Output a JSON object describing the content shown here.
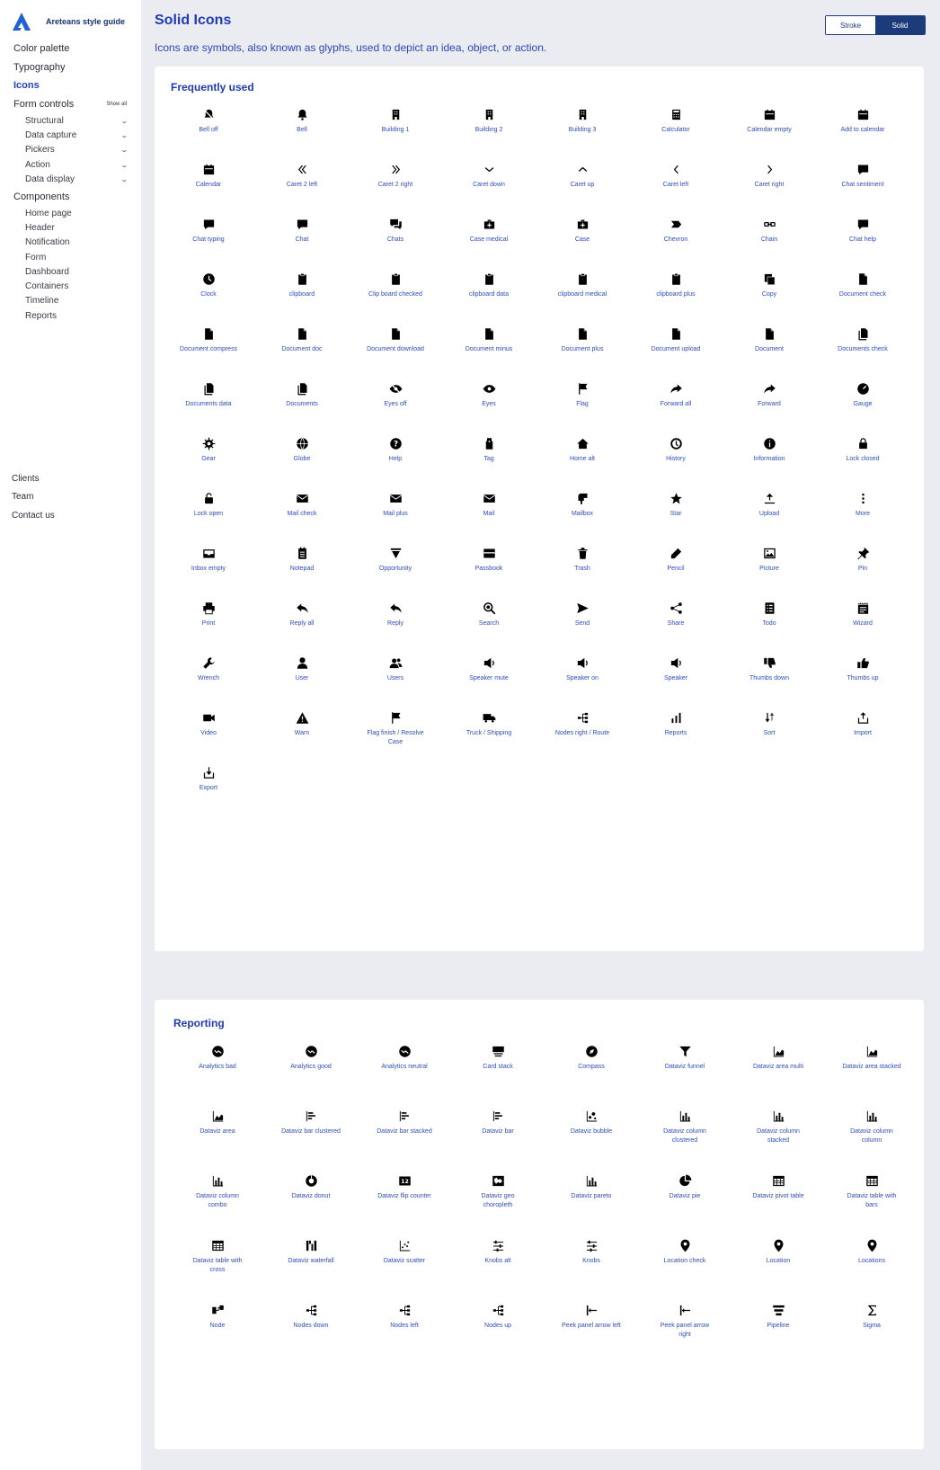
{
  "sidebar": {
    "brand": "Areteans style guide",
    "items": [
      {
        "label": "Color palette"
      },
      {
        "label": "Typography"
      },
      {
        "label": "Icons",
        "active": true
      },
      {
        "label": "Form controls",
        "action": "Show all"
      }
    ],
    "form_controls": [
      "Structural",
      "Data capture",
      "Pickers",
      "Action",
      "Data display"
    ],
    "components_label": "Components",
    "components": [
      "Home page",
      "Header",
      "Notification",
      "Form",
      "Dashboard",
      "Containers",
      "Timeline",
      "Reports"
    ],
    "bottom": [
      "Clients",
      "Team",
      "Contact us"
    ]
  },
  "header": {
    "title": "Solid Icons",
    "description": "Icons are symbols, also known as glyphs, used to depict an idea, object, or action.",
    "toggle": {
      "stroke": "Stroke",
      "solid": "Solid"
    }
  },
  "colors": {
    "accent": "#1e3ab8",
    "link": "#2f4cc8",
    "toggle_active": "#1c3b7a",
    "page_bg": "#ebecf1"
  },
  "sections": [
    {
      "title": "Frequently used",
      "icons": [
        {
          "label": "Bell off",
          "icon": "bell-off-icon"
        },
        {
          "label": "Bell",
          "icon": "bell-icon"
        },
        {
          "label": "Building 1",
          "icon": "building-icon"
        },
        {
          "label": "Building 2",
          "icon": "building-icon"
        },
        {
          "label": "Building 3",
          "icon": "building-icon"
        },
        {
          "label": "Calculator",
          "icon": "calculator-icon"
        },
        {
          "label": "Calendar empty",
          "icon": "calendar-icon"
        },
        {
          "label": "Add to calendar",
          "icon": "calendar-icon"
        },
        {
          "label": "Calendar",
          "icon": "calendar-icon"
        },
        {
          "label": "Caret 2 left",
          "icon": "caret-double-left-icon"
        },
        {
          "label": "Caret 2 right",
          "icon": "caret-double-right-icon"
        },
        {
          "label": "Caret down",
          "icon": "caret-down-icon"
        },
        {
          "label": "Caret up",
          "icon": "caret-up-icon"
        },
        {
          "label": "Caret left",
          "icon": "caret-left-icon"
        },
        {
          "label": "Caret right",
          "icon": "caret-right-icon"
        },
        {
          "label": "Chat sentiment",
          "icon": "chat-icon"
        },
        {
          "label": "Chat typing",
          "icon": "chat-icon"
        },
        {
          "label": "Chat",
          "icon": "chat-icon"
        },
        {
          "label": "Chats",
          "icon": "chats-icon"
        },
        {
          "label": "Case medical",
          "icon": "case-icon"
        },
        {
          "label": "Case",
          "icon": "case-icon"
        },
        {
          "label": "Chevron",
          "icon": "chevron-icon"
        },
        {
          "label": "Chain",
          "icon": "chain-icon"
        },
        {
          "label": "Chat help",
          "icon": "chat-icon"
        },
        {
          "label": "Clock",
          "icon": "clock-icon"
        },
        {
          "label": "clipboard",
          "icon": "clipboard-icon"
        },
        {
          "label": "Clip board checked",
          "icon": "clipboard-icon"
        },
        {
          "label": "clipboard data",
          "icon": "clipboard-icon"
        },
        {
          "label": "clipboard medical",
          "icon": "clipboard-icon"
        },
        {
          "label": "clipboard plus",
          "icon": "clipboard-icon"
        },
        {
          "label": "Copy",
          "icon": "copy-icon"
        },
        {
          "label": "Document check",
          "icon": "document-icon"
        },
        {
          "label": "Document compress",
          "icon": "document-icon"
        },
        {
          "label": "Document doc",
          "icon": "document-icon"
        },
        {
          "label": "Document download",
          "icon": "document-icon"
        },
        {
          "label": "Document minus",
          "icon": "document-icon"
        },
        {
          "label": "Document plus",
          "icon": "document-icon"
        },
        {
          "label": "Document upload",
          "icon": "document-icon"
        },
        {
          "label": "Document",
          "icon": "document-icon"
        },
        {
          "label": "Documents check",
          "icon": "documents-icon"
        },
        {
          "label": "Documents data",
          "icon": "documents-icon"
        },
        {
          "label": "Documents",
          "icon": "documents-icon"
        },
        {
          "label": "Eyes off",
          "icon": "eye-off-icon"
        },
        {
          "label": "Eyes",
          "icon": "eye-icon"
        },
        {
          "label": "Flag",
          "icon": "flag-icon"
        },
        {
          "label": "Forward all",
          "icon": "forward-icon"
        },
        {
          "label": "Forward",
          "icon": "forward-icon"
        },
        {
          "label": "Gauge",
          "icon": "gauge-icon"
        },
        {
          "label": "Gear",
          "icon": "gear-icon"
        },
        {
          "label": "Globe",
          "icon": "globe-icon"
        },
        {
          "label": "Help",
          "icon": "help-icon"
        },
        {
          "label": "Tag",
          "icon": "tag-icon"
        },
        {
          "label": "Home alt",
          "icon": "home-icon"
        },
        {
          "label": "History",
          "icon": "history-icon"
        },
        {
          "label": "Information",
          "icon": "information-icon"
        },
        {
          "label": "Lock closed",
          "icon": "lock-icon"
        },
        {
          "label": "Lock open",
          "icon": "lock-open-icon"
        },
        {
          "label": "Mail check",
          "icon": "mail-icon"
        },
        {
          "label": "Mail plus",
          "icon": "mail-icon"
        },
        {
          "label": "Mail",
          "icon": "mail-icon"
        },
        {
          "label": "Mailbox",
          "icon": "mailbox-icon"
        },
        {
          "label": "Star",
          "icon": "star-icon"
        },
        {
          "label": "Upload",
          "icon": "upload-icon"
        },
        {
          "label": "More",
          "icon": "more-icon"
        },
        {
          "label": "Inbox empty",
          "icon": "inbox-icon"
        },
        {
          "label": "Notepad",
          "icon": "notepad-icon"
        },
        {
          "label": "Opportunity",
          "icon": "opportunity-icon"
        },
        {
          "label": "Passbook",
          "icon": "passbook-icon"
        },
        {
          "label": "Trash",
          "icon": "trash-icon"
        },
        {
          "label": "Pencil",
          "icon": "pencil-icon"
        },
        {
          "label": "Picture",
          "icon": "picture-icon"
        },
        {
          "label": "Pin",
          "icon": "pin-icon"
        },
        {
          "label": "Print",
          "icon": "print-icon"
        },
        {
          "label": "Reply all",
          "icon": "reply-icon"
        },
        {
          "label": "Reply",
          "icon": "reply-icon"
        },
        {
          "label": "Search",
          "icon": "search-icon"
        },
        {
          "label": "Send",
          "icon": "send-icon"
        },
        {
          "label": "Share",
          "icon": "share-icon"
        },
        {
          "label": "Todo",
          "icon": "todo-icon"
        },
        {
          "label": "Wizard",
          "icon": "wizard-icon"
        },
        {
          "label": "Wrench",
          "icon": "wrench-icon"
        },
        {
          "label": "User",
          "icon": "user-icon"
        },
        {
          "label": "Users",
          "icon": "users-icon"
        },
        {
          "label": "Speaker mute",
          "icon": "speaker-icon"
        },
        {
          "label": "Speaker on",
          "icon": "speaker-icon"
        },
        {
          "label": "Speaker",
          "icon": "speaker-icon"
        },
        {
          "label": "Thumbs down",
          "icon": "thumbs-down-icon"
        },
        {
          "label": "Thumbs up",
          "icon": "thumbs-up-icon"
        },
        {
          "label": "Video",
          "icon": "video-icon"
        },
        {
          "label": "Warn",
          "icon": "warn-icon"
        },
        {
          "label": "Flag finish / Resolve Case",
          "icon": "flag-icon"
        },
        {
          "label": "Truck / Shipping",
          "icon": "truck-icon"
        },
        {
          "label": "Nodes right / Route",
          "icon": "nodes-icon"
        },
        {
          "label": "Reports",
          "icon": "reports-icon"
        },
        {
          "label": "Sort",
          "icon": "sort-icon"
        },
        {
          "label": "Import",
          "icon": "import-icon"
        },
        {
          "label": "Export",
          "icon": "export-icon"
        }
      ]
    },
    {
      "title": "Reporting",
      "icons": [
        {
          "label": "Analytics bad",
          "icon": "analytics-icon"
        },
        {
          "label": "Analytics good",
          "icon": "analytics-icon"
        },
        {
          "label": "Analytics neutral",
          "icon": "analytics-icon"
        },
        {
          "label": "Card stack",
          "icon": "card-stack-icon"
        },
        {
          "label": "Compass",
          "icon": "compass-icon"
        },
        {
          "label": "Dataviz funnel",
          "icon": "funnel-icon"
        },
        {
          "label": "Dataviz area multi",
          "icon": "area-chart-icon"
        },
        {
          "label": "Dataviz area stacked",
          "icon": "area-chart-icon"
        },
        {
          "label": "Dataviz area",
          "icon": "area-chart-icon"
        },
        {
          "label": "Dataviz bar clustered",
          "icon": "bar-chart-icon"
        },
        {
          "label": "Dataviz bar stacked",
          "icon": "bar-chart-icon"
        },
        {
          "label": "Dataviz bar",
          "icon": "bar-chart-icon"
        },
        {
          "label": "Dataviz bubble",
          "icon": "bubble-chart-icon"
        },
        {
          "label": "Dataviz column clustered",
          "icon": "column-chart-icon"
        },
        {
          "label": "Dataviz column stacked",
          "icon": "column-chart-icon"
        },
        {
          "label": "Dataviz column column",
          "icon": "column-chart-icon"
        },
        {
          "label": "Dataviz column combo",
          "icon": "column-chart-icon"
        },
        {
          "label": "Dataviz donut",
          "icon": "donut-icon"
        },
        {
          "label": "Dataviz flip counter",
          "icon": "counter-icon"
        },
        {
          "label": "Dataviz geo choropleth",
          "icon": "map-icon"
        },
        {
          "label": "Dataviz pareto",
          "icon": "column-chart-icon"
        },
        {
          "label": "Dataviz pie",
          "icon": "pie-icon"
        },
        {
          "label": "Dataviz pivot table",
          "icon": "table-icon"
        },
        {
          "label": "Dataviz table with bars",
          "icon": "table-icon"
        },
        {
          "label": "Dataviz table with cross",
          "icon": "table-icon"
        },
        {
          "label": "Dataviz waterfall",
          "icon": "waterfall-icon"
        },
        {
          "label": "Dataviz scatter",
          "icon": "scatter-icon"
        },
        {
          "label": "Knobs alt",
          "icon": "knobs-icon"
        },
        {
          "label": "Knobs",
          "icon": "knobs-icon"
        },
        {
          "label": "Location check",
          "icon": "location-icon"
        },
        {
          "label": "Location",
          "icon": "location-icon"
        },
        {
          "label": "Locations",
          "icon": "location-icon"
        },
        {
          "label": "Node",
          "icon": "node-icon"
        },
        {
          "label": "Nodes down",
          "icon": "nodes-icon"
        },
        {
          "label": "Nodes left",
          "icon": "nodes-icon"
        },
        {
          "label": "Nodes up",
          "icon": "nodes-icon"
        },
        {
          "label": "Peek panel arrow left",
          "icon": "peek-panel-icon"
        },
        {
          "label": "Peek panel arrow right",
          "icon": "peek-panel-icon"
        },
        {
          "label": "Pipeline",
          "icon": "pipeline-icon"
        },
        {
          "label": "Sigma",
          "icon": "sigma-icon"
        }
      ]
    }
  ]
}
